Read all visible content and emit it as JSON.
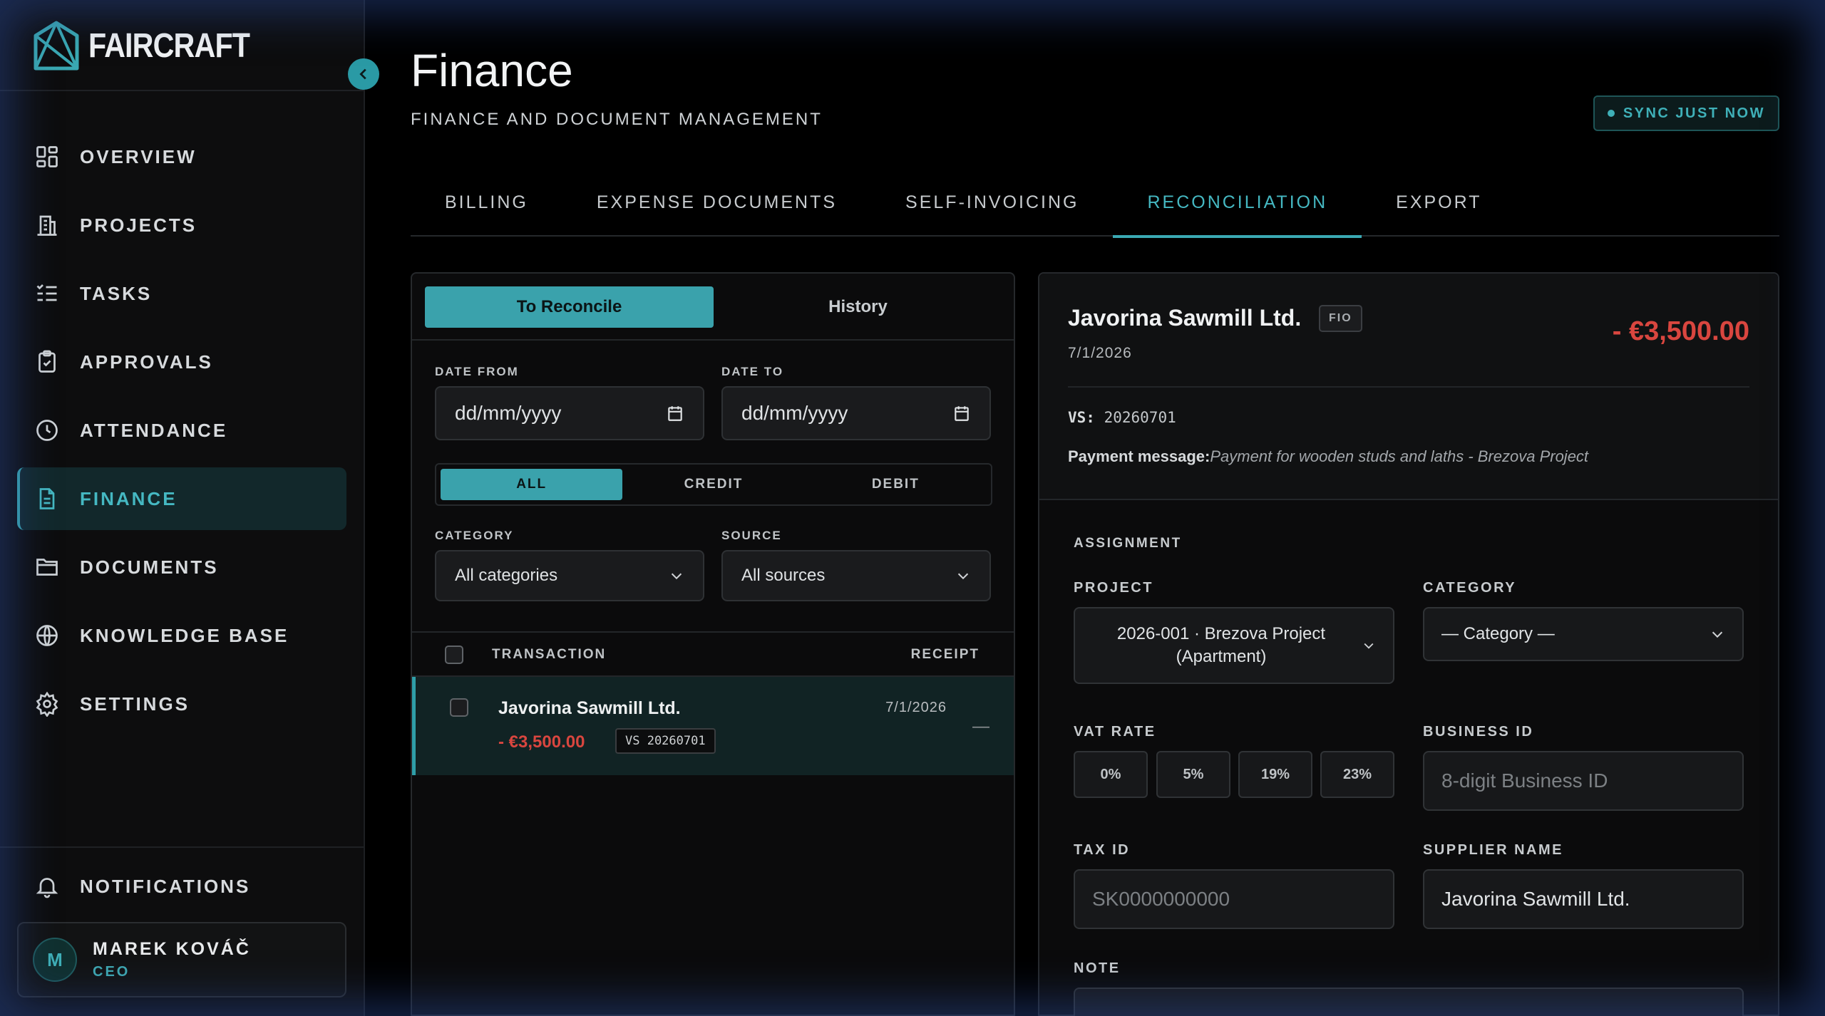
{
  "brand": {
    "name": "FAIRCRAFT"
  },
  "sidebar": {
    "items": [
      {
        "label": "OVERVIEW",
        "icon": "grid-icon"
      },
      {
        "label": "PROJECTS",
        "icon": "building-icon"
      },
      {
        "label": "TASKS",
        "icon": "checklist-icon"
      },
      {
        "label": "APPROVALS",
        "icon": "clipboard-check-icon"
      },
      {
        "label": "ATTENDANCE",
        "icon": "clock-icon"
      },
      {
        "label": "FINANCE",
        "icon": "document-icon",
        "active": true
      },
      {
        "label": "DOCUMENTS",
        "icon": "folder-icon"
      },
      {
        "label": "KNOWLEDGE BASE",
        "icon": "globe-icon"
      },
      {
        "label": "SETTINGS",
        "icon": "gear-icon"
      }
    ],
    "notifications_label": "NOTIFICATIONS",
    "user": {
      "initial": "M",
      "name": "MAREK KOVÁČ",
      "role": "CEO"
    }
  },
  "header": {
    "title": "Finance",
    "subtitle": "FINANCE AND DOCUMENT MANAGEMENT",
    "sync_label": "SYNC JUST NOW"
  },
  "tabs": [
    {
      "label": "BILLING"
    },
    {
      "label": "EXPENSE DOCUMENTS"
    },
    {
      "label": "SELF-INVOICING"
    },
    {
      "label": "RECONCILIATION",
      "active": true
    },
    {
      "label": "EXPORT"
    }
  ],
  "reconcile": {
    "segments": {
      "to_reconcile": "To Reconcile",
      "history": "History",
      "active": "To Reconcile"
    },
    "filters": {
      "date_from_label": "DATE FROM",
      "date_from_value": "dd/mm/yyyy",
      "date_to_label": "DATE TO",
      "date_to_value": "dd/mm/yyyy",
      "type_options": [
        "ALL",
        "CREDIT",
        "DEBIT"
      ],
      "type_selected": "ALL",
      "category_label": "CATEGORY",
      "category_value": "All categories",
      "source_label": "SOURCE",
      "source_value": "All sources"
    },
    "table": {
      "columns": {
        "transaction": "TRANSACTION",
        "receipt": "RECEIPT"
      },
      "rows": [
        {
          "name": "Javorina Sawmill Ltd.",
          "date": "7/1/2026",
          "amount": "- €3,500.00",
          "vs": "VS 20260701",
          "receipt": "—"
        }
      ]
    }
  },
  "detail": {
    "name": "Javorina Sawmill Ltd.",
    "source_badge": "FIO",
    "date": "7/1/2026",
    "amount": "- €3,500.00",
    "vs_label": "VS:",
    "vs_value": "20260701",
    "payment_label": "Payment message:",
    "payment_message": "Payment for wooden studs and laths - Brezova Project",
    "assignment_label": "ASSIGNMENT",
    "project_label": "PROJECT",
    "project_value": "2026-001 · Brezova Project (Apartment)",
    "category_label": "CATEGORY",
    "category_value": "— Category —",
    "vat_label": "VAT RATE",
    "vat_options": [
      "0%",
      "5%",
      "19%",
      "23%"
    ],
    "business_id_label": "BUSINESS ID",
    "business_id_placeholder": "8-digit Business ID",
    "tax_id_label": "TAX ID",
    "tax_id_placeholder": "SK0000000000",
    "supplier_label": "SUPPLIER NAME",
    "supplier_value": "Javorina Sawmill Ltd.",
    "note_label": "NOTE"
  },
  "colors": {
    "accent": "#3aa2ac",
    "negative": "#d9463f",
    "background": "#000000"
  }
}
